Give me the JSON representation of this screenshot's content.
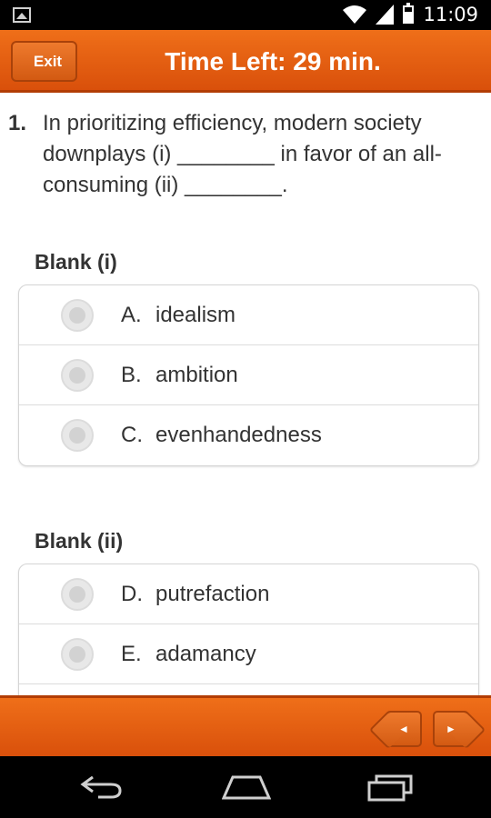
{
  "status_bar": {
    "time": "11:09"
  },
  "header": {
    "exit_label": "Exit",
    "timer_text": "Time Left: 29 min."
  },
  "question": {
    "number": "1.",
    "text": "In prioritizing efficiency, modern society downplays (i) ________ in favor of an all-consuming (ii) ________."
  },
  "blanks": [
    {
      "label": "Blank (i)",
      "options": [
        {
          "letter": "A.",
          "text": "idealism"
        },
        {
          "letter": "B.",
          "text": "ambition"
        },
        {
          "letter": "C.",
          "text": "evenhandedness"
        }
      ]
    },
    {
      "label": "Blank (ii)",
      "options": [
        {
          "letter": "D.",
          "text": "putrefaction"
        },
        {
          "letter": "E.",
          "text": "adamancy"
        }
      ]
    }
  ],
  "footer": {
    "prev_symbol": "◄",
    "next_symbol": "►"
  },
  "colors": {
    "accent": "#e5600f",
    "accent_dark": "#b23d05"
  }
}
